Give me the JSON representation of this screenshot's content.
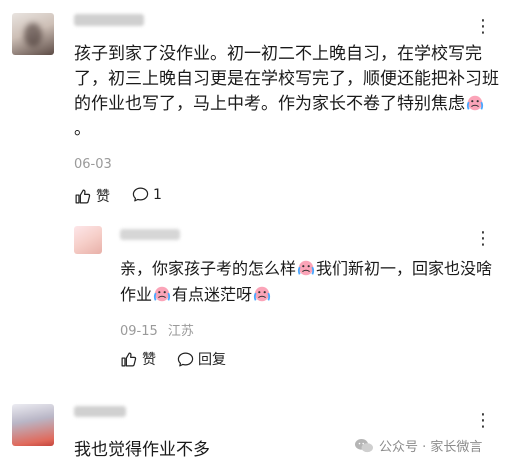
{
  "comments": [
    {
      "text_before_emoji": "孩子到家了没作业。初一初二不上晚自习，在学校写完了，初三上晚自习更是在学校写完了，顺便还能把补习班的作业也写了，马上中考。作为家长不卷了特别焦虑",
      "emoji_icon": "crying-face-emoji",
      "text_after_emoji": "。",
      "date": "06-03",
      "like_label": "赞",
      "comment_count": "1",
      "more_icon": "more-dots-icon"
    },
    {
      "text_part1": "亲，你家孩子考的怎么样",
      "text_part2": "我们新初一，回家也没啥作业",
      "text_part3": "有点迷茫呀",
      "emoji_icon": "crying-face-emoji",
      "date": "09-15",
      "location": "江苏",
      "like_label": "赞",
      "reply_label": "回复",
      "more_icon": "more-dots-icon"
    },
    {
      "text": "我也觉得作业不多",
      "more_icon": "more-dots-icon"
    }
  ],
  "watermark": {
    "label": "公众号 · 家长微言",
    "icon": "wechat-logo-icon"
  }
}
